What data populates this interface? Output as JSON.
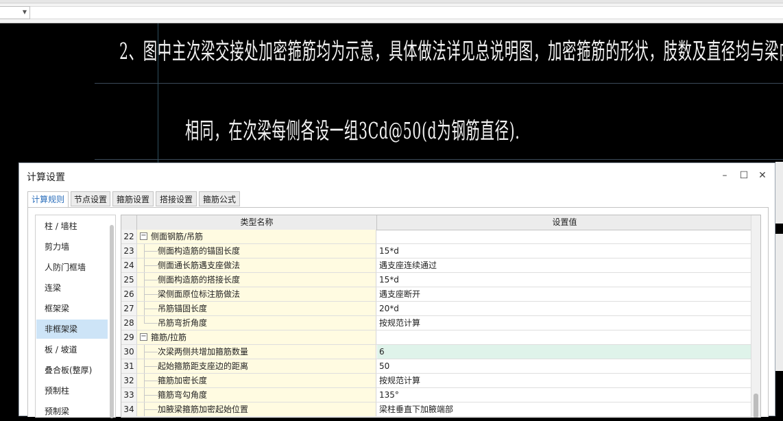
{
  "cad": {
    "line1": "2、图中主次梁交接处加密箍筋均为示意，具体做法详见总说明图，加密箍筋的形状，肢数及直径均与梁内箍筋",
    "line2": "相同，在次梁每侧各设一组3Cd@50(d为钢筋直径)."
  },
  "dialog": {
    "title": "计算设置",
    "tabs": [
      "计算规则",
      "节点设置",
      "箍筋设置",
      "搭接设置",
      "箍筋公式"
    ],
    "active_tab": "计算规则",
    "left_items": [
      "柱 / 墙柱",
      "剪力墙",
      "人防门框墙",
      "连梁",
      "框架梁",
      "非框架梁",
      "板 / 坡道",
      "叠合板(整厚)",
      "预制柱",
      "预制梁"
    ],
    "selected_left": "非框架梁",
    "grid": {
      "headers": [
        "类型名称",
        "设置值"
      ],
      "rows": [
        {
          "num": "22",
          "name": "侧面钢筋/吊筋",
          "value": "",
          "category": true
        },
        {
          "num": "23",
          "name": "侧面构造筋的锚固长度",
          "value": "15*d"
        },
        {
          "num": "24",
          "name": "侧面通长筋遇支座做法",
          "value": "遇支座连续通过"
        },
        {
          "num": "25",
          "name": "侧面构造筋的搭接长度",
          "value": "15*d"
        },
        {
          "num": "26",
          "name": "梁侧面原位标注筋做法",
          "value": "遇支座断开"
        },
        {
          "num": "27",
          "name": "吊筋锚固长度",
          "value": "20*d"
        },
        {
          "num": "28",
          "name": "吊筋弯折角度",
          "value": "按规范计算"
        },
        {
          "num": "29",
          "name": "箍筋/拉筋",
          "value": "",
          "category": true
        },
        {
          "num": "30",
          "name": "次梁两侧共增加箍筋数量",
          "value": "6",
          "highlight": true
        },
        {
          "num": "31",
          "name": "起始箍筋距支座边的距离",
          "value": "50"
        },
        {
          "num": "32",
          "name": "箍筋加密长度",
          "value": "按规范计算"
        },
        {
          "num": "33",
          "name": "箍筋弯勾角度",
          "value": "135°"
        },
        {
          "num": "34",
          "name": "加腋梁箍筋加密起始位置",
          "value": "梁柱垂直下加腋端部"
        }
      ]
    }
  },
  "colors": {
    "selection": "#cde4f7",
    "name_cell": "#fffbe1",
    "highlight_value": "#dff3ea",
    "active_tab_text": "#2a6ebb"
  }
}
